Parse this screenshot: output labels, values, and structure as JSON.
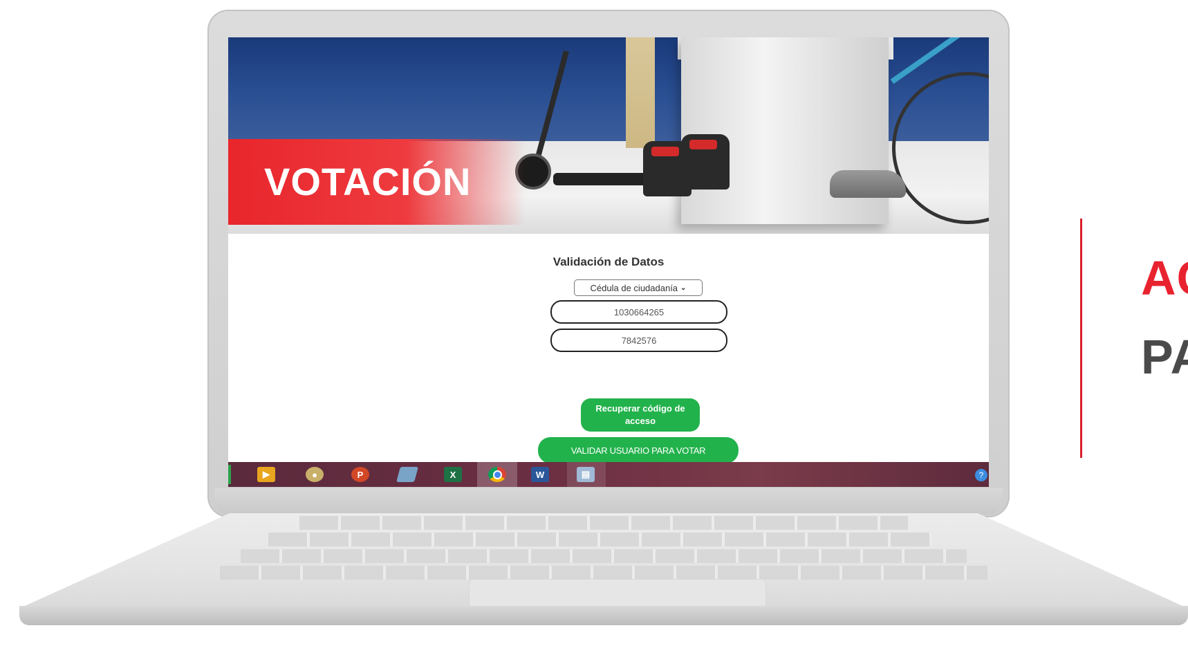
{
  "banner": {
    "title": "VOTACIÓN"
  },
  "form": {
    "heading": "Validación de Datos",
    "document_type": {
      "selected": "Cédula de ciudadanía"
    },
    "document_number": "1030664265",
    "code_field": "7842576",
    "recover_button": "Recuperar código de acceso",
    "validate_button": "VALIDAR USUARIO PARA VOTAR"
  },
  "taskbar": {
    "icons": [
      {
        "name": "media-player-icon"
      },
      {
        "name": "paint-icon"
      },
      {
        "name": "powerpoint-icon",
        "glyph": "P"
      },
      {
        "name": "notes-icon"
      },
      {
        "name": "excel-icon",
        "glyph": "X"
      },
      {
        "name": "chrome-icon"
      },
      {
        "name": "word-icon",
        "glyph": "W"
      },
      {
        "name": "file-explorer-icon"
      }
    ],
    "help_glyph": "?"
  },
  "caption": {
    "line1": "AC",
    "line2": "PA"
  },
  "colors": {
    "accent_red": "#e8232f",
    "button_green": "#22b24c",
    "caption_gray": "#4a4a4a"
  }
}
